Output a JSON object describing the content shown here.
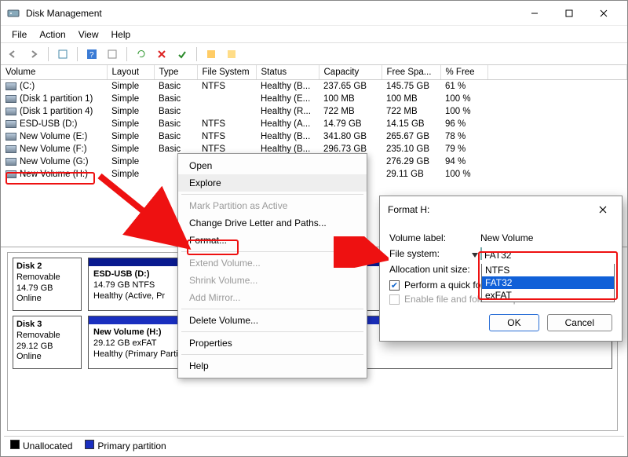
{
  "window": {
    "title": "Disk Management"
  },
  "menu": {
    "file": "File",
    "action": "Action",
    "view": "View",
    "help": "Help"
  },
  "columns": {
    "volume": "Volume",
    "layout": "Layout",
    "type": "Type",
    "fs": "File System",
    "status": "Status",
    "capacity": "Capacity",
    "free": "Free Spa...",
    "pctfree": "% Free"
  },
  "rows": [
    {
      "vol": "(C:)",
      "layout": "Simple",
      "type": "Basic",
      "fs": "NTFS",
      "status": "Healthy (B...",
      "cap": "237.65 GB",
      "free": "145.75 GB",
      "pct": "61 %"
    },
    {
      "vol": "(Disk 1 partition 1)",
      "layout": "Simple",
      "type": "Basic",
      "fs": "",
      "status": "Healthy (E...",
      "cap": "100 MB",
      "free": "100 MB",
      "pct": "100 %"
    },
    {
      "vol": "(Disk 1 partition 4)",
      "layout": "Simple",
      "type": "Basic",
      "fs": "",
      "status": "Healthy (R...",
      "cap": "722 MB",
      "free": "722 MB",
      "pct": "100 %"
    },
    {
      "vol": "ESD-USB (D:)",
      "layout": "Simple",
      "type": "Basic",
      "fs": "NTFS",
      "status": "Healthy (A...",
      "cap": "14.79 GB",
      "free": "14.15 GB",
      "pct": "96 %"
    },
    {
      "vol": "New Volume (E:)",
      "layout": "Simple",
      "type": "Basic",
      "fs": "NTFS",
      "status": "Healthy (B...",
      "cap": "341.80 GB",
      "free": "265.67 GB",
      "pct": "78 %"
    },
    {
      "vol": "New Volume (F:)",
      "layout": "Simple",
      "type": "Basic",
      "fs": "NTFS",
      "status": "Healthy (B...",
      "cap": "296.73 GB",
      "free": "235.10 GB",
      "pct": "79 %"
    },
    {
      "vol": "New Volume (G:)",
      "layout": "Simple",
      "type": "",
      "fs": "",
      "status": "",
      "cap": "",
      "free": "276.29 GB",
      "pct": "94 %",
      "suffix": "GB"
    },
    {
      "vol": "New Volume (H:)",
      "layout": "Simple",
      "type": "",
      "fs": "",
      "status": "",
      "cap": "",
      "free": "29.11 GB",
      "pct": "100 %",
      "suffix": "GB"
    }
  ],
  "ctx": {
    "open": "Open",
    "explore": "Explore",
    "mark": "Mark Partition as Active",
    "change": "Change Drive Letter and Paths...",
    "format": "Format...",
    "extend": "Extend Volume...",
    "shrink": "Shrink Volume...",
    "mirror": "Add Mirror...",
    "delete": "Delete Volume...",
    "props": "Properties",
    "help": "Help"
  },
  "disks": [
    {
      "title": "Disk 2",
      "type": "Removable",
      "size": "14.79 GB",
      "state": "Online",
      "part_title": "ESD-USB  (D:)",
      "part_line2": "14.79 GB NTFS",
      "part_line3": "Healthy (Active, Pr"
    },
    {
      "title": "Disk 3",
      "type": "Removable",
      "size": "29.12 GB",
      "state": "Online",
      "part_title": "New Volume (H:)",
      "part_line2": "29.12 GB exFAT",
      "part_line3": "Healthy (Primary Partition)"
    }
  ],
  "legend": {
    "unalloc": "Unallocated",
    "primary": "Primary partition"
  },
  "dialog": {
    "title": "Format H:",
    "vol_label_lab": "Volume label:",
    "vol_label_val": "New Volume",
    "fs_lab": "File system:",
    "fs_sel": "FAT32",
    "alloc_lab": "Allocation unit size:",
    "opts": [
      "NTFS",
      "FAT32",
      "exFAT"
    ],
    "quick": "Perform a quick format",
    "compress": "Enable file and folder compression",
    "ok": "OK",
    "cancel": "Cancel"
  }
}
